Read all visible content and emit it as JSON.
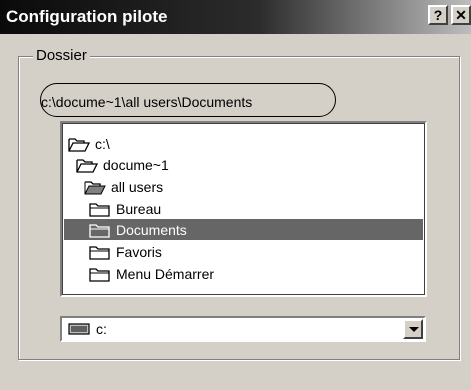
{
  "window": {
    "title": "Configuration pilote",
    "help_label": "?",
    "close_label": "✕"
  },
  "group": {
    "legend": "Dossier"
  },
  "path": "c:\\docume~1\\all users\\Documents",
  "dirs": [
    {
      "label": "c:\\",
      "icon": "open-folder-icon",
      "selected": false
    },
    {
      "label": "docume~1",
      "icon": "open-folder-icon",
      "selected": false
    },
    {
      "label": "all users",
      "icon": "open-folder-icon",
      "selected": false
    },
    {
      "label": "Bureau",
      "icon": "folder-icon",
      "selected": false
    },
    {
      "label": "Documents",
      "icon": "folder-icon",
      "selected": true
    },
    {
      "label": "Favoris",
      "icon": "folder-icon",
      "selected": false
    },
    {
      "label": "Menu Démarrer",
      "icon": "folder-icon",
      "selected": false
    }
  ],
  "drive": {
    "selected": "c:",
    "icon": "drive-icon"
  },
  "colors": {
    "dialog_bg": "#d4d0c8",
    "selection_bg": "#666666"
  }
}
